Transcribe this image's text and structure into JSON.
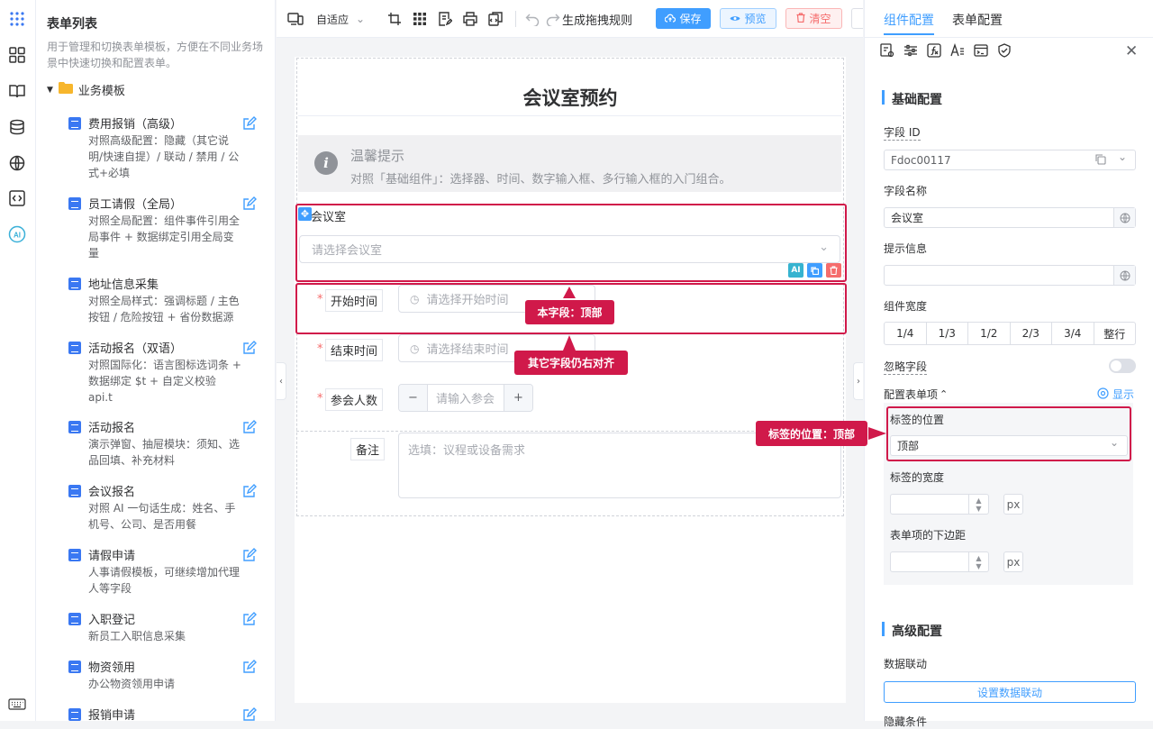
{
  "sidebar": {
    "title": "表单列表",
    "desc": "用于管理和切换表单模板，方便在不同业务场景中快速切换和配置表单。",
    "group": "业务模板",
    "items": [
      {
        "name": "费用报销（高级）",
        "desc": "对照高级配置：隐藏（其它说明/快速自提）/ 联动 / 禁用 / 公式+必填"
      },
      {
        "name": "员工请假（全局）",
        "desc": "对照全局配置：组件事件引用全局事件 + 数据绑定引用全局变量"
      },
      {
        "name": "地址信息采集",
        "desc": "对照全局样式：强调标题 / 主色按钮 / 危险按钮 + 省份数据源"
      },
      {
        "name": "活动报名（双语）",
        "desc": "对照国际化：语言图标选词条 + 数据绑定 $t + 自定义校验 api.t"
      },
      {
        "name": "活动报名",
        "desc": "演示弹窗、抽屉模块：须知、选品回填、补充材料"
      },
      {
        "name": "会议报名",
        "desc": "对照 AI 一句话生成：姓名、手机号、公司、是否用餐"
      },
      {
        "name": "请假申请",
        "desc": "人事请假模板，可继续增加代理人等字段"
      },
      {
        "name": "入职登记",
        "desc": "新员工入职信息采集"
      },
      {
        "name": "物资领用",
        "desc": "办公物资领用申请"
      },
      {
        "name": "报销申请",
        "desc": ""
      }
    ]
  },
  "toolbar": {
    "mode": "自适应",
    "rules": "生成拖拽规则",
    "save": "保存",
    "preview": "预览",
    "clear": "清空"
  },
  "form": {
    "title": "会议室预约",
    "alert_title": "温馨提示",
    "alert_desc": "对照「基础组件」：选择器、时间、数字输入框、多行输入框的入门组合。",
    "room_label": "会议室",
    "room_placeholder": "请选择会议室",
    "start_label": "开始时间",
    "start_placeholder": "请选择开始时间",
    "end_label": "结束时间",
    "end_placeholder": "请选择结束时间",
    "count_label": "参会人数",
    "count_placeholder": "请输入参会",
    "note_label": "备注",
    "note_placeholder": "选填：议程或设备需求",
    "callout_this": "本字段：顶部",
    "callout_other": "其它字段仍右对齐",
    "ai_badge": "AI"
  },
  "right": {
    "tab_component": "组件配置",
    "tab_form": "表单配置",
    "basic": "基础配置",
    "field_id_label": "字段 ID",
    "field_id": "Fdoc00117",
    "field_name_label": "字段名称",
    "field_name": "会议室",
    "tip_label": "提示信息",
    "width_label": "组件宽度",
    "width_options": [
      "1/4",
      "1/3",
      "1/2",
      "2/3",
      "3/4",
      "整行"
    ],
    "ignore_label": "忽略字段",
    "config_items": "配置表单项",
    "show": "显示",
    "label_pos_label": "标签的位置",
    "label_pos": "顶部",
    "label_width_label": "标签的宽度",
    "margin_label": "表单项的下边距",
    "unit": "px",
    "callout": "标签的位置：顶部",
    "advanced": "高级配置",
    "linkage_label": "数据联动",
    "linkage_btn": "设置数据联动",
    "hidden_label": "隐藏条件"
  },
  "colors": {
    "primary": "#409eff",
    "danger": "#f56c6c",
    "highlight": "#d0194a"
  }
}
